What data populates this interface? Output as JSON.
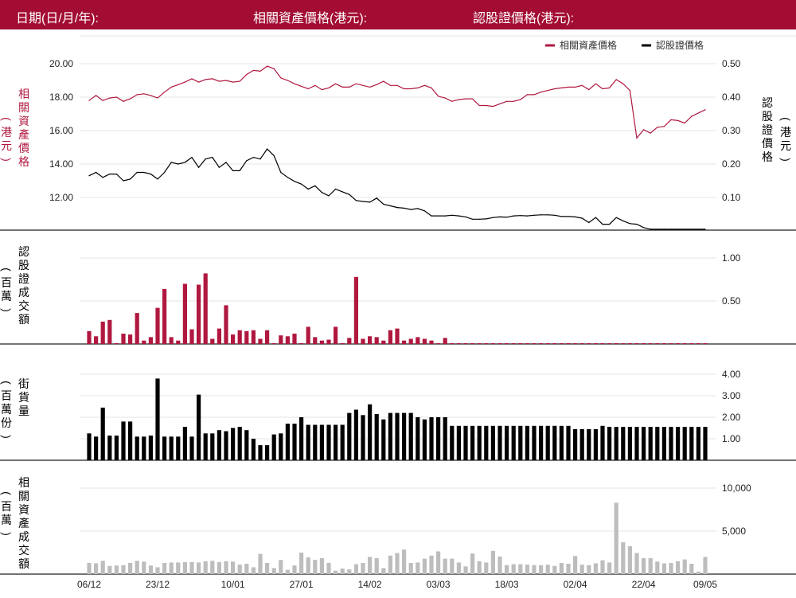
{
  "header": {
    "date_label": "日期(日/月/年):",
    "asset_price_label": "相關資產價格(港元):",
    "warrant_price_label": "認股證價格(港元):"
  },
  "legend": {
    "asset": "相關資產價格",
    "warrant": "認股證價格"
  },
  "colors": {
    "header_bg": "#a30d33",
    "asset": "#b0183f",
    "warrant": "#000000",
    "turnover_bar": "#b0183f",
    "street_bar": "#000000",
    "asset_turnover_bar": "#bdbdbd"
  },
  "axis_titles": {
    "asset_price": [
      "相",
      "關",
      "資",
      "產",
      "價",
      "格"
    ],
    "asset_unit": [
      "(",
      "港",
      "元",
      ")"
    ],
    "warrant_price": [
      "認",
      "股",
      "證",
      "價",
      "格"
    ],
    "warrant_unit": [
      "(",
      "港",
      "元",
      ")"
    ],
    "warrant_turnover": [
      "認",
      "股",
      "證",
      "成",
      "交",
      "額"
    ],
    "warrant_turnover_unit": [
      "(",
      "百",
      "萬",
      ")"
    ],
    "street": [
      "街",
      "貨",
      "量"
    ],
    "street_unit": [
      "(",
      "百",
      "萬",
      "份",
      ")"
    ],
    "asset_turnover": [
      "相",
      "關",
      "資",
      "產",
      "成",
      "交",
      "額"
    ],
    "asset_turnover_unit": [
      "(",
      "百",
      "萬",
      ")"
    ]
  },
  "x_ticks": [
    "06/12",
    "23/12",
    "10/01",
    "27/01",
    "14/02",
    "03/03",
    "18/03",
    "02/04",
    "22/04",
    "09/05"
  ],
  "chart_data": [
    {
      "type": "line",
      "title": "",
      "n_points": 91,
      "x_tick_labels": [
        "06/12",
        "23/12",
        "10/01",
        "27/01",
        "14/02",
        "03/03",
        "18/03",
        "02/04",
        "22/04",
        "09/05"
      ],
      "yleft_ticks": [
        "20.00",
        "18.00",
        "16.00",
        "14.00",
        "12.00"
      ],
      "yright_ticks": [
        "0.50",
        "0.40",
        "0.30",
        "0.20",
        "0.10"
      ],
      "yleft_lim": [
        10.2,
        20.4
      ],
      "yright_lim": [
        0.005,
        0.51
      ],
      "legend_position": "top-right",
      "series": [
        {
          "name": "相關資產價格",
          "axis": "left",
          "values": [
            17.8,
            18.1,
            17.8,
            17.95,
            18.0,
            17.75,
            17.9,
            18.15,
            18.2,
            18.1,
            17.95,
            18.3,
            18.6,
            18.75,
            18.9,
            19.1,
            18.9,
            19.05,
            19.1,
            18.95,
            19.0,
            18.9,
            18.95,
            19.35,
            19.6,
            19.55,
            19.85,
            19.7,
            19.15,
            19.0,
            18.8,
            18.65,
            18.5,
            18.7,
            18.45,
            18.55,
            18.8,
            18.6,
            18.6,
            18.8,
            18.7,
            18.6,
            18.75,
            18.95,
            18.7,
            18.7,
            18.5,
            18.5,
            18.55,
            18.7,
            18.55,
            18.05,
            17.95,
            17.75,
            17.85,
            17.9,
            17.9,
            17.5,
            17.5,
            17.45,
            17.6,
            17.75,
            17.75,
            17.85,
            18.15,
            18.15,
            18.3,
            18.4,
            18.5,
            18.55,
            18.6,
            18.6,
            18.7,
            18.45,
            18.8,
            18.5,
            18.55,
            19.05,
            18.8,
            18.4,
            15.55,
            16.05,
            15.85,
            16.2,
            16.25,
            16.65,
            16.6,
            16.45,
            16.85,
            17.05,
            17.25
          ]
        },
        {
          "name": "認股證價格",
          "axis": "right",
          "values": [
            0.165,
            0.175,
            0.16,
            0.17,
            0.17,
            0.15,
            0.155,
            0.175,
            0.175,
            0.17,
            0.155,
            0.175,
            0.205,
            0.2,
            0.205,
            0.22,
            0.19,
            0.215,
            0.22,
            0.19,
            0.205,
            0.18,
            0.18,
            0.21,
            0.22,
            0.215,
            0.245,
            0.225,
            0.175,
            0.16,
            0.148,
            0.14,
            0.125,
            0.135,
            0.115,
            0.105,
            0.125,
            0.117,
            0.109,
            0.091,
            0.088,
            0.086,
            0.098,
            0.08,
            0.075,
            0.07,
            0.068,
            0.064,
            0.067,
            0.06,
            0.045,
            0.045,
            0.045,
            0.047,
            0.045,
            0.042,
            0.035,
            0.035,
            0.036,
            0.04,
            0.042,
            0.041,
            0.045,
            0.046,
            0.045,
            0.047,
            0.048,
            0.048,
            0.047,
            0.043,
            0.043,
            0.042,
            0.038,
            0.025,
            0.04,
            0.02,
            0.02,
            0.04,
            0.03,
            0.022,
            0.02,
            0.01,
            0.005,
            0.005,
            0.005,
            0.005,
            0.005,
            0.005,
            0.005,
            0.005,
            0.005
          ]
        }
      ]
    },
    {
      "type": "bar",
      "title": "",
      "name": "認股證成交額",
      "y_ticks": [
        "1.00",
        "0.50"
      ],
      "ylim": [
        0,
        1.28
      ],
      "values": [
        0.15,
        0.09,
        0.26,
        0.28,
        0.01,
        0.12,
        0.11,
        0.36,
        0.04,
        0.08,
        0.42,
        0.64,
        0.08,
        0.04,
        0.7,
        0.17,
        0.69,
        0.82,
        0.06,
        0.18,
        0.45,
        0.11,
        0.16,
        0.15,
        0.16,
        0.06,
        0.16,
        0.01,
        0.1,
        0.09,
        0.12,
        0.01,
        0.2,
        0.08,
        0.04,
        0.05,
        0.2,
        0.01,
        0.07,
        0.78,
        0.06,
        0.09,
        0.08,
        0.04,
        0.16,
        0.18,
        0.04,
        0.06,
        0.08,
        0.06,
        0.04,
        0.01,
        0.07,
        0.01,
        0.01,
        0.01,
        0.01,
        0.0,
        0.0,
        0.01,
        0.0,
        0.01,
        0.0,
        0.01,
        0.0,
        0.0,
        0.01,
        0.0,
        0.01,
        0.01,
        0.01,
        0.0,
        0.0,
        0.0,
        0.01,
        0.01,
        0.0,
        0.01,
        0.0,
        0.0,
        0.0,
        0.01,
        0.0,
        0.0,
        0.0,
        0.0,
        0.0,
        0.0,
        0.0,
        0.0,
        0.0
      ]
    },
    {
      "type": "bar",
      "title": "",
      "name": "街貨量",
      "y_ticks": [
        "4.00",
        "3.00",
        "2.00",
        "1.00"
      ],
      "ylim": [
        0,
        4.25
      ],
      "values": [
        1.25,
        1.1,
        2.45,
        1.15,
        1.15,
        1.8,
        1.8,
        1.1,
        1.1,
        1.15,
        3.8,
        1.1,
        1.1,
        1.1,
        1.55,
        1.1,
        3.05,
        1.25,
        1.25,
        1.4,
        1.35,
        1.5,
        1.55,
        1.4,
        1.0,
        0.7,
        0.7,
        1.2,
        1.25,
        1.7,
        1.7,
        2.0,
        1.65,
        1.65,
        1.65,
        1.65,
        1.65,
        1.65,
        2.2,
        2.35,
        2.1,
        2.6,
        2.15,
        1.9,
        2.2,
        2.2,
        2.2,
        2.2,
        2.0,
        1.9,
        2.0,
        2.0,
        2.0,
        1.6,
        1.6,
        1.6,
        1.6,
        1.6,
        1.6,
        1.6,
        1.6,
        1.6,
        1.6,
        1.6,
        1.6,
        1.6,
        1.6,
        1.6,
        1.6,
        1.6,
        1.6,
        1.45,
        1.45,
        1.45,
        1.45,
        1.6,
        1.55,
        1.55,
        1.55,
        1.55,
        1.55,
        1.55,
        1.55,
        1.55,
        1.55,
        1.55,
        1.55,
        1.55,
        1.55,
        1.55,
        1.55
      ]
    },
    {
      "type": "bar",
      "title": "",
      "name": "相關資產成交額",
      "y_ticks": [
        "10,000",
        "5,000"
      ],
      "ylim": [
        0,
        12500
      ],
      "values": [
        1300,
        1250,
        1550,
        950,
        1000,
        1050,
        1300,
        1550,
        1450,
        1000,
        800,
        1300,
        1350,
        1350,
        1400,
        1400,
        1350,
        1500,
        1550,
        1400,
        1500,
        1450,
        1100,
        1200,
        800,
        2350,
        1300,
        700,
        1650,
        500,
        1000,
        2500,
        1950,
        1650,
        1850,
        1300,
        400,
        650,
        550,
        1150,
        1300,
        2000,
        1850,
        700,
        2150,
        2450,
        2850,
        1300,
        1350,
        1800,
        2150,
        2650,
        1800,
        1800,
        1350,
        900,
        2400,
        1500,
        1350,
        2700,
        2050,
        1050,
        1150,
        1150,
        1100,
        1050,
        1050,
        1100,
        950,
        1300,
        1200,
        2100,
        1100,
        1050,
        1250,
        1600,
        1350,
        8300,
        3700,
        3250,
        2450,
        1850,
        1850,
        1450,
        1250,
        1300,
        1500,
        1700,
        1200,
        300,
        2000
      ]
    }
  ]
}
